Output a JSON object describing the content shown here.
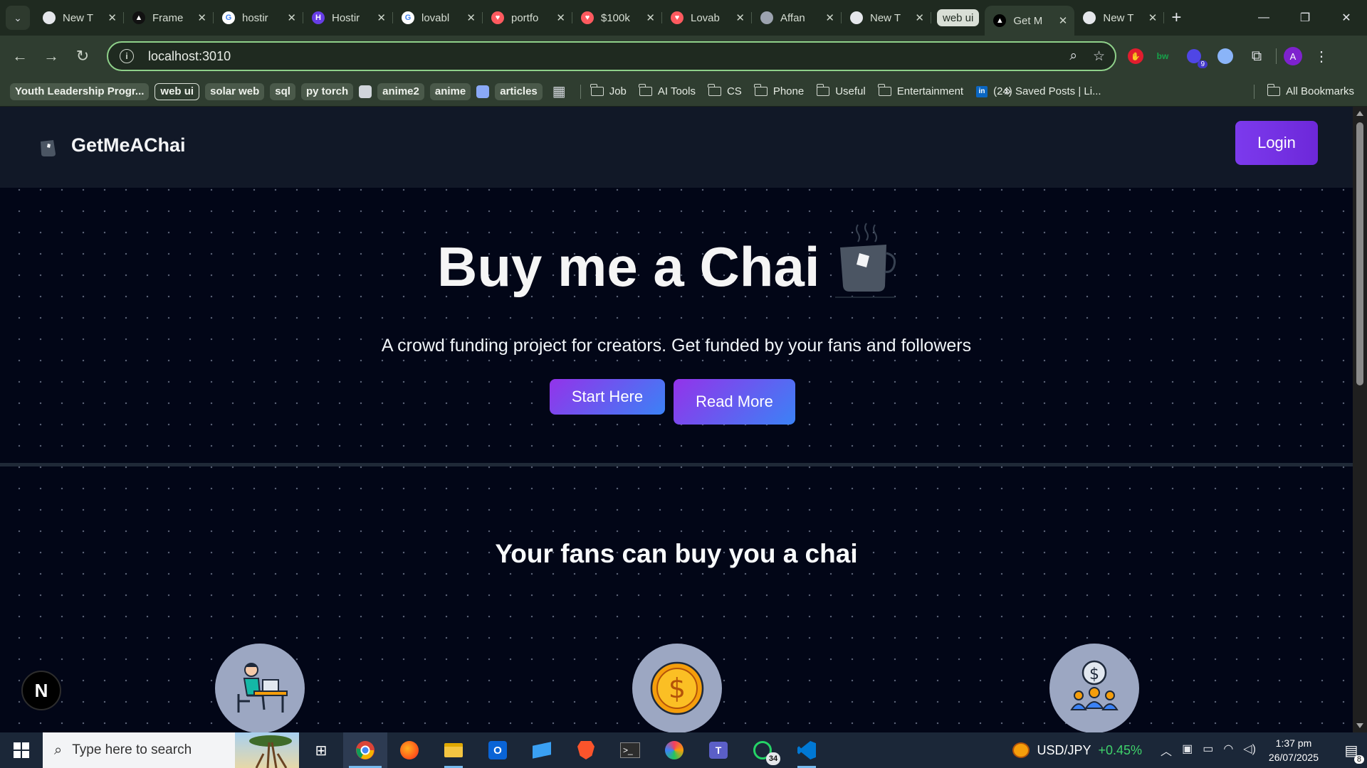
{
  "browser": {
    "tabs": [
      {
        "label": "New T",
        "icon": "chrome-icon",
        "fav_color": "#e5e7eb",
        "fav_text": ""
      },
      {
        "label": "Frame",
        "icon": "framer-icon",
        "fav_color": "#111111",
        "fav_text": "▲"
      },
      {
        "label": "hostir",
        "icon": "google-icon",
        "fav_color": "#ffffff",
        "fav_text": "G"
      },
      {
        "label": "Hostir",
        "icon": "hostinger-icon",
        "fav_color": "#673de6",
        "fav_text": "H"
      },
      {
        "label": "lovabl",
        "icon": "google-icon",
        "fav_color": "#ffffff",
        "fav_text": "G"
      },
      {
        "label": "portfo",
        "icon": "lovable-icon",
        "fav_color": "#ff5a5f",
        "fav_text": "♥"
      },
      {
        "label": "$100k",
        "icon": "lovable-icon",
        "fav_color": "#ff5a5f",
        "fav_text": "♥"
      },
      {
        "label": "Lovab",
        "icon": "lovable-icon",
        "fav_color": "#ff5a5f",
        "fav_text": "♥"
      },
      {
        "label": "Affan",
        "icon": "globe-icon",
        "fav_color": "#9ca3af",
        "fav_text": ""
      },
      {
        "label": "New T",
        "icon": "chrome-icon",
        "fav_color": "#e5e7eb",
        "fav_text": ""
      }
    ],
    "tab_group_label": "web ui",
    "active_tab": {
      "label": "Get M",
      "icon": "vercel-icon"
    },
    "last_tab": {
      "label": "New T",
      "icon": "chrome-icon"
    },
    "url": "localhost:3010",
    "extension_badge": "9",
    "profile_initial": "A",
    "bookmarks_chips": [
      "Youth Leadership Progr...",
      "web ui",
      "solar web",
      "sql",
      "py torch",
      "anime2",
      "anime",
      "articles"
    ],
    "bookmark_folders": [
      "Job",
      "AI Tools",
      "CS",
      "Phone",
      "Useful",
      "Entertainment"
    ],
    "linkedin_bookmark": "(24) Saved Posts | Li...",
    "all_bookmarks": "All Bookmarks"
  },
  "site": {
    "brand": "GetMeAChai",
    "login": "Login",
    "hero_title": "Buy me a Chai",
    "hero_subtitle": "A crowd funding project for creators. Get funded by your fans and followers",
    "start_button": "Start Here",
    "read_button": "Read More",
    "section_title": "Your fans can buy you a chai",
    "feature_icons": [
      "person-at-laptop-icon",
      "dollar-coin-icon",
      "group-funding-icon"
    ],
    "next_badge": "N"
  },
  "taskbar": {
    "search_placeholder": "Type here to search",
    "whatsapp_badge": "34",
    "ticker_symbol": "USD/JPY",
    "ticker_change": "+0.45%",
    "time": "1:37 pm",
    "date": "26/07/2025",
    "notifications": "8"
  },
  "colors": {
    "accent": "#7c3aed",
    "page_bg": "#020617",
    "ticker_up": "#3fd26b"
  }
}
